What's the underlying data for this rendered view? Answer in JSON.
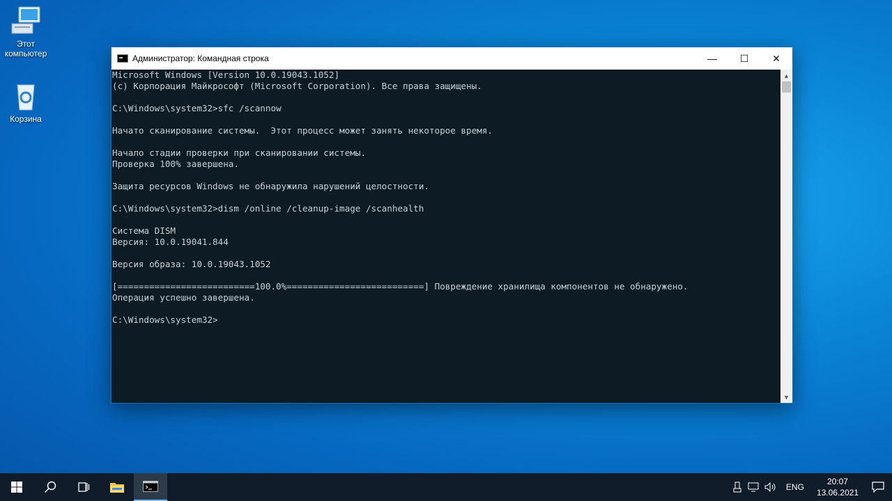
{
  "desktop": {
    "icons": [
      {
        "label": "Этот компьютер",
        "icon": "computer-icon"
      },
      {
        "label": "Корзина",
        "icon": "recycle-bin-icon"
      }
    ]
  },
  "window": {
    "title": "Администратор: Командная строка",
    "buttons": {
      "minimize": "—",
      "maximize": "☐",
      "close": "✕"
    },
    "console_text": "Microsoft Windows [Version 10.0.19043.1052]\n(c) Корпорация Майкрософт (Microsoft Corporation). Все права защищены.\n\nC:\\Windows\\system32>sfc /scannow\n\nНачато сканирование системы.  Этот процесс может занять некоторое время.\n\nНачало стадии проверки при сканировании системы.\nПроверка 100% завершена.\n\nЗащита ресурсов Windows не обнаружила нарушений целостности.\n\nC:\\Windows\\system32>dism /online /cleanup-image /scanhealth\n\nСистема DISM\nВерсия: 10.0.19041.844\n\nВерсия образа: 10.0.19043.1052\n\n[==========================100.0%==========================] Повреждение хранилища компонентов не обнаружено.\nОперация успешно завершена.\n\nC:\\Windows\\system32>"
  },
  "taskbar": {
    "items": [
      "start-icon",
      "search-icon",
      "task-view-icon",
      "file-explorer-icon",
      "cmd-icon"
    ],
    "language": "ENG",
    "time": "20:07",
    "date": "13.06.2021"
  },
  "colors": {
    "console_bg": "#0c1b24",
    "console_text": "#c9d1d6",
    "taskbar_bg": "#101c2a",
    "accent": "#76b9ed"
  }
}
